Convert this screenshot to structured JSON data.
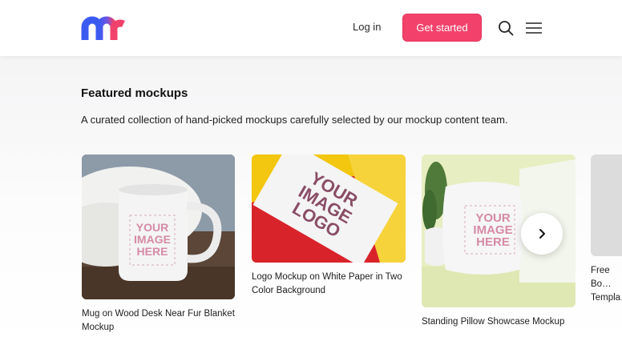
{
  "header": {
    "logo_icon": "m-logo-icon",
    "login_label": "Log in",
    "cta_label": "Get started",
    "search_icon": "search-icon",
    "menu_icon": "menu-icon"
  },
  "section": {
    "title": "Featured mockups",
    "subtitle": "A curated collection of hand-picked mockups carefully selected by our mockup content team."
  },
  "cards": [
    {
      "title": "Mug on Wood Desk Near Fur Blanket Mockup",
      "image_text": [
        "YOUR",
        "IMAGE",
        "HERE"
      ]
    },
    {
      "title": "Logo Mockup on White Paper in Two Color Background",
      "image_text": [
        "YOUR",
        "IMAGE",
        "LOGO"
      ]
    },
    {
      "title": "Standing Pillow Showcase Mockup",
      "image_text": [
        "YOUR",
        "IMAGE",
        "HERE"
      ]
    },
    {
      "title": "Free Bo… Templa…"
    }
  ],
  "carousel": {
    "next_icon": "chevron-right-icon"
  },
  "colors": {
    "accent": "#f2426b",
    "logo_blue": "#3b5bf0",
    "logo_pink": "#f2426b"
  }
}
